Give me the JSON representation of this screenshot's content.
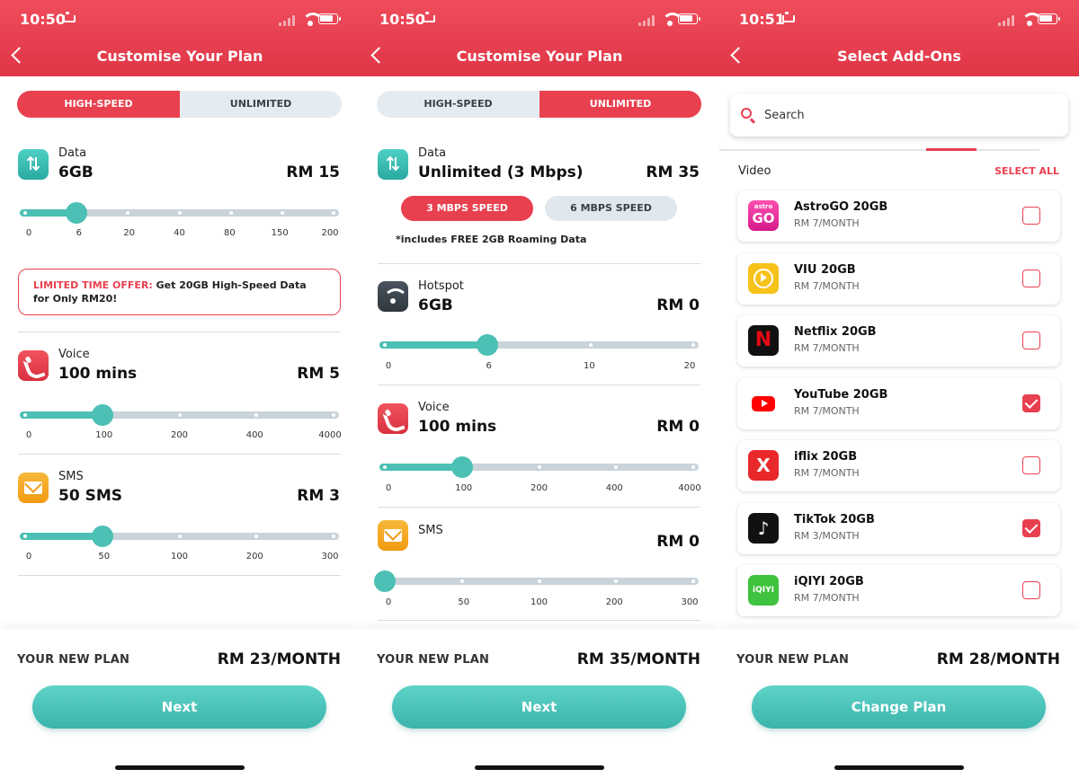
{
  "screens": [
    {
      "status_time": "10:50",
      "title": "Customise Your Plan",
      "toggle": {
        "high_speed": "HIGH-SPEED",
        "unlimited": "UNLIMITED",
        "selected": "HIGH-SPEED"
      },
      "data": {
        "label": "Data",
        "value": "6GB",
        "price": "RM 15",
        "ticks": [
          "0",
          "6",
          "20",
          "40",
          "80",
          "150",
          "200"
        ],
        "selected_index": 1
      },
      "offer": {
        "highlight": "LIMITED TIME OFFER:",
        "text": " Get 20GB High-Speed Data for Only RM20!"
      },
      "voice": {
        "label": "Voice",
        "value": "100 mins",
        "price": "RM 5",
        "ticks": [
          "0",
          "100",
          "200",
          "400",
          "4000"
        ],
        "selected_index": 1
      },
      "sms": {
        "label": "SMS",
        "value": "50 SMS",
        "price": "RM 3",
        "ticks": [
          "0",
          "50",
          "100",
          "200",
          "300"
        ],
        "selected_index": 1
      },
      "footer": {
        "label": "YOUR NEW PLAN",
        "price": "RM 23/MONTH",
        "button": "Next"
      }
    },
    {
      "status_time": "10:50",
      "title": "Customise Your Plan",
      "toggle": {
        "high_speed": "HIGH-SPEED",
        "unlimited": "UNLIMITED",
        "selected": "UNLIMITED"
      },
      "data": {
        "label": "Data",
        "value": "Unlimited (3 Mbps)",
        "price": "RM 35"
      },
      "speeds": {
        "option1": "3 MBPS SPEED",
        "option2": "6 MBPS SPEED",
        "selected": "3 MBPS SPEED"
      },
      "roaming_note": "*includes FREE 2GB Roaming Data",
      "hotspot": {
        "label": "Hotspot",
        "value": "6GB",
        "price": "RM 0",
        "ticks": [
          "0",
          "6",
          "10",
          "20"
        ],
        "selected_index": 1
      },
      "voice": {
        "label": "Voice",
        "value": "100 mins",
        "price": "RM 0",
        "ticks": [
          "0",
          "100",
          "200",
          "400",
          "4000"
        ],
        "selected_index": 1
      },
      "sms": {
        "label": "SMS",
        "value": "",
        "price": "RM 0",
        "ticks": [
          "0",
          "50",
          "100",
          "200",
          "300"
        ],
        "selected_index": 0
      },
      "footer": {
        "label": "YOUR NEW PLAN",
        "price": "RM 35/MONTH",
        "button": "Next"
      }
    },
    {
      "status_time": "10:51",
      "title": "Select Add-Ons",
      "search_placeholder": "Search",
      "category": "Video",
      "select_all": "SELECT ALL",
      "addons": [
        {
          "name": "AstroGO 20GB",
          "price": "RM 7/MONTH",
          "checked": false,
          "logo": "astro-go-logo",
          "logo_text": "GO",
          "logo_small": "astro"
        },
        {
          "name": "VIU 20GB",
          "price": "RM 7/MONTH",
          "checked": false,
          "logo": "viu-logo"
        },
        {
          "name": "Netflix 20GB",
          "price": "RM 7/MONTH",
          "checked": false,
          "logo": "netflix-logo",
          "logo_text": "N"
        },
        {
          "name": "YouTube 20GB",
          "price": "RM 7/MONTH",
          "checked": true,
          "logo": "youtube-logo"
        },
        {
          "name": "iflix 20GB",
          "price": "RM 7/MONTH",
          "checked": false,
          "logo": "iflix-logo",
          "logo_text": "X"
        },
        {
          "name": "TikTok 20GB",
          "price": "RM 3/MONTH",
          "checked": true,
          "logo": "tiktok-logo",
          "logo_text": "♪"
        },
        {
          "name": "iQIYI 20GB",
          "price": "RM 7/MONTH",
          "checked": false,
          "logo": "iqiyi-logo",
          "logo_text": "iQIYI"
        }
      ],
      "footer": {
        "label": "YOUR NEW PLAN",
        "price": "RM 28/MONTH",
        "button": "Change Plan"
      }
    }
  ],
  "colors": {
    "brand_red": "#e8404f",
    "teal": "#4cc0b4",
    "track": "#c9d3da"
  },
  "icons": {
    "data": "data-arrows-icon",
    "voice": "phone-icon",
    "sms": "envelope-icon",
    "hotspot": "wifi-icon",
    "search": "search-icon",
    "back": "back-chevron-icon"
  }
}
